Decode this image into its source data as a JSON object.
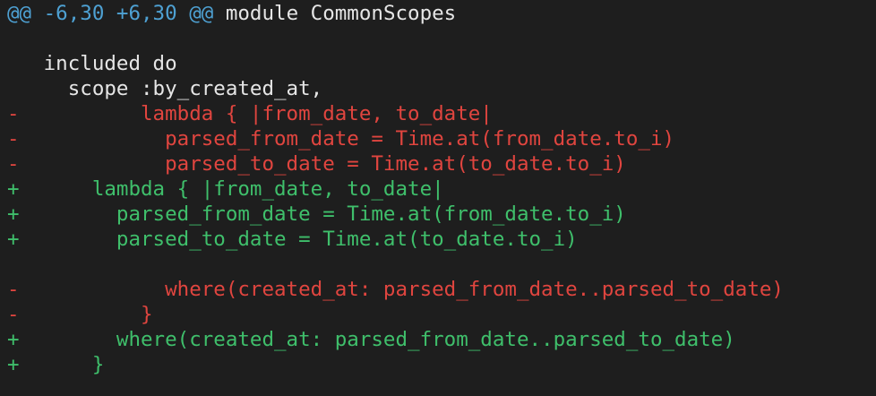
{
  "hunk": {
    "marker": "@@ -6,30 +6,30 @@",
    "context": " module CommonScopes"
  },
  "lines": [
    {
      "type": "blank",
      "text": ""
    },
    {
      "type": "context",
      "text": "   included do"
    },
    {
      "type": "context",
      "text": "     scope :by_created_at,"
    },
    {
      "type": "removed",
      "text": "-          lambda { |from_date, to_date|"
    },
    {
      "type": "removed",
      "text": "-            parsed_from_date = Time.at(from_date.to_i)"
    },
    {
      "type": "removed",
      "text": "-            parsed_to_date = Time.at(to_date.to_i)"
    },
    {
      "type": "added",
      "text": "+      lambda { |from_date, to_date|"
    },
    {
      "type": "added",
      "text": "+        parsed_from_date = Time.at(from_date.to_i)"
    },
    {
      "type": "added",
      "text": "+        parsed_to_date = Time.at(to_date.to_i)"
    },
    {
      "type": "blank",
      "text": ""
    },
    {
      "type": "removed",
      "text": "-            where(created_at: parsed_from_date..parsed_to_date)"
    },
    {
      "type": "removed",
      "text": "-          }"
    },
    {
      "type": "added",
      "text": "+        where(created_at: parsed_from_date..parsed_to_date)"
    },
    {
      "type": "added",
      "text": "+      }"
    }
  ],
  "colors": {
    "background": "#1e1e1e",
    "hunk_marker": "#4ea1d3",
    "context": "#e6e6e6",
    "removed": "#e0453f",
    "added": "#3fbf6b"
  }
}
